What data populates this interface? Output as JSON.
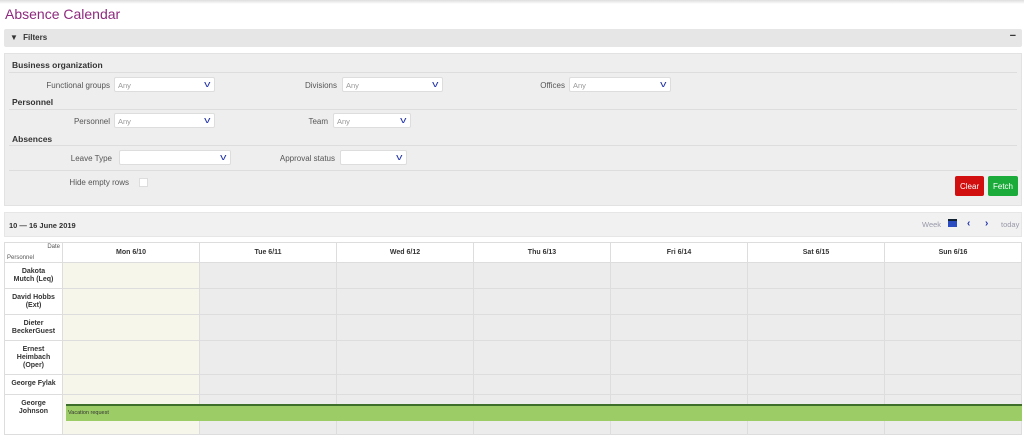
{
  "page": {
    "title": "Absence Calendar"
  },
  "filters": {
    "header": "Filters",
    "collapse_icon": "minus-icon",
    "sections": {
      "business": "Business organization",
      "personnel": "Personnel",
      "absences": "Absences"
    },
    "functional_groups": {
      "label": "Functional groups",
      "value": "Any"
    },
    "divisions": {
      "label": "Divisions",
      "value": "Any"
    },
    "offices": {
      "label": "Offices",
      "value": "Any"
    },
    "personnel": {
      "label": "Personnel",
      "value": "Any"
    },
    "team": {
      "label": "Team",
      "value": "Any"
    },
    "leave_type": {
      "label": "Leave Type",
      "value": ""
    },
    "approval_status": {
      "label": "Approval status",
      "value": ""
    },
    "hide_empty_rows": {
      "label": "Hide empty rows",
      "checked": false
    },
    "clear": "Clear",
    "fetch": "Fetch",
    "colors": {
      "clear": "#d10f0f",
      "fetch": "#1aab3a"
    }
  },
  "calendar": {
    "range": "10 — 16 June 2019",
    "view": "Week",
    "today": "today",
    "corner_date": "Date",
    "corner_personnel": "Personnel",
    "days": [
      "Mon 6/10",
      "Tue 6/11",
      "Wed 6/12",
      "Thu 6/13",
      "Fri 6/14",
      "Sat 6/15",
      "Sun 6/16"
    ],
    "rows": [
      "Dakota Mutch (Leq)",
      "David Hobbs (Ext)",
      "Dieter BeckerGuest",
      "Ernest Heimbach (Oper)",
      "George Fylak",
      "George Johnson"
    ],
    "events": [
      {
        "person": "George Johnson",
        "label": "Vacation request",
        "start": "Mon 6/10",
        "end": "Sun 6/16",
        "color": "#9ccc65"
      }
    ]
  }
}
